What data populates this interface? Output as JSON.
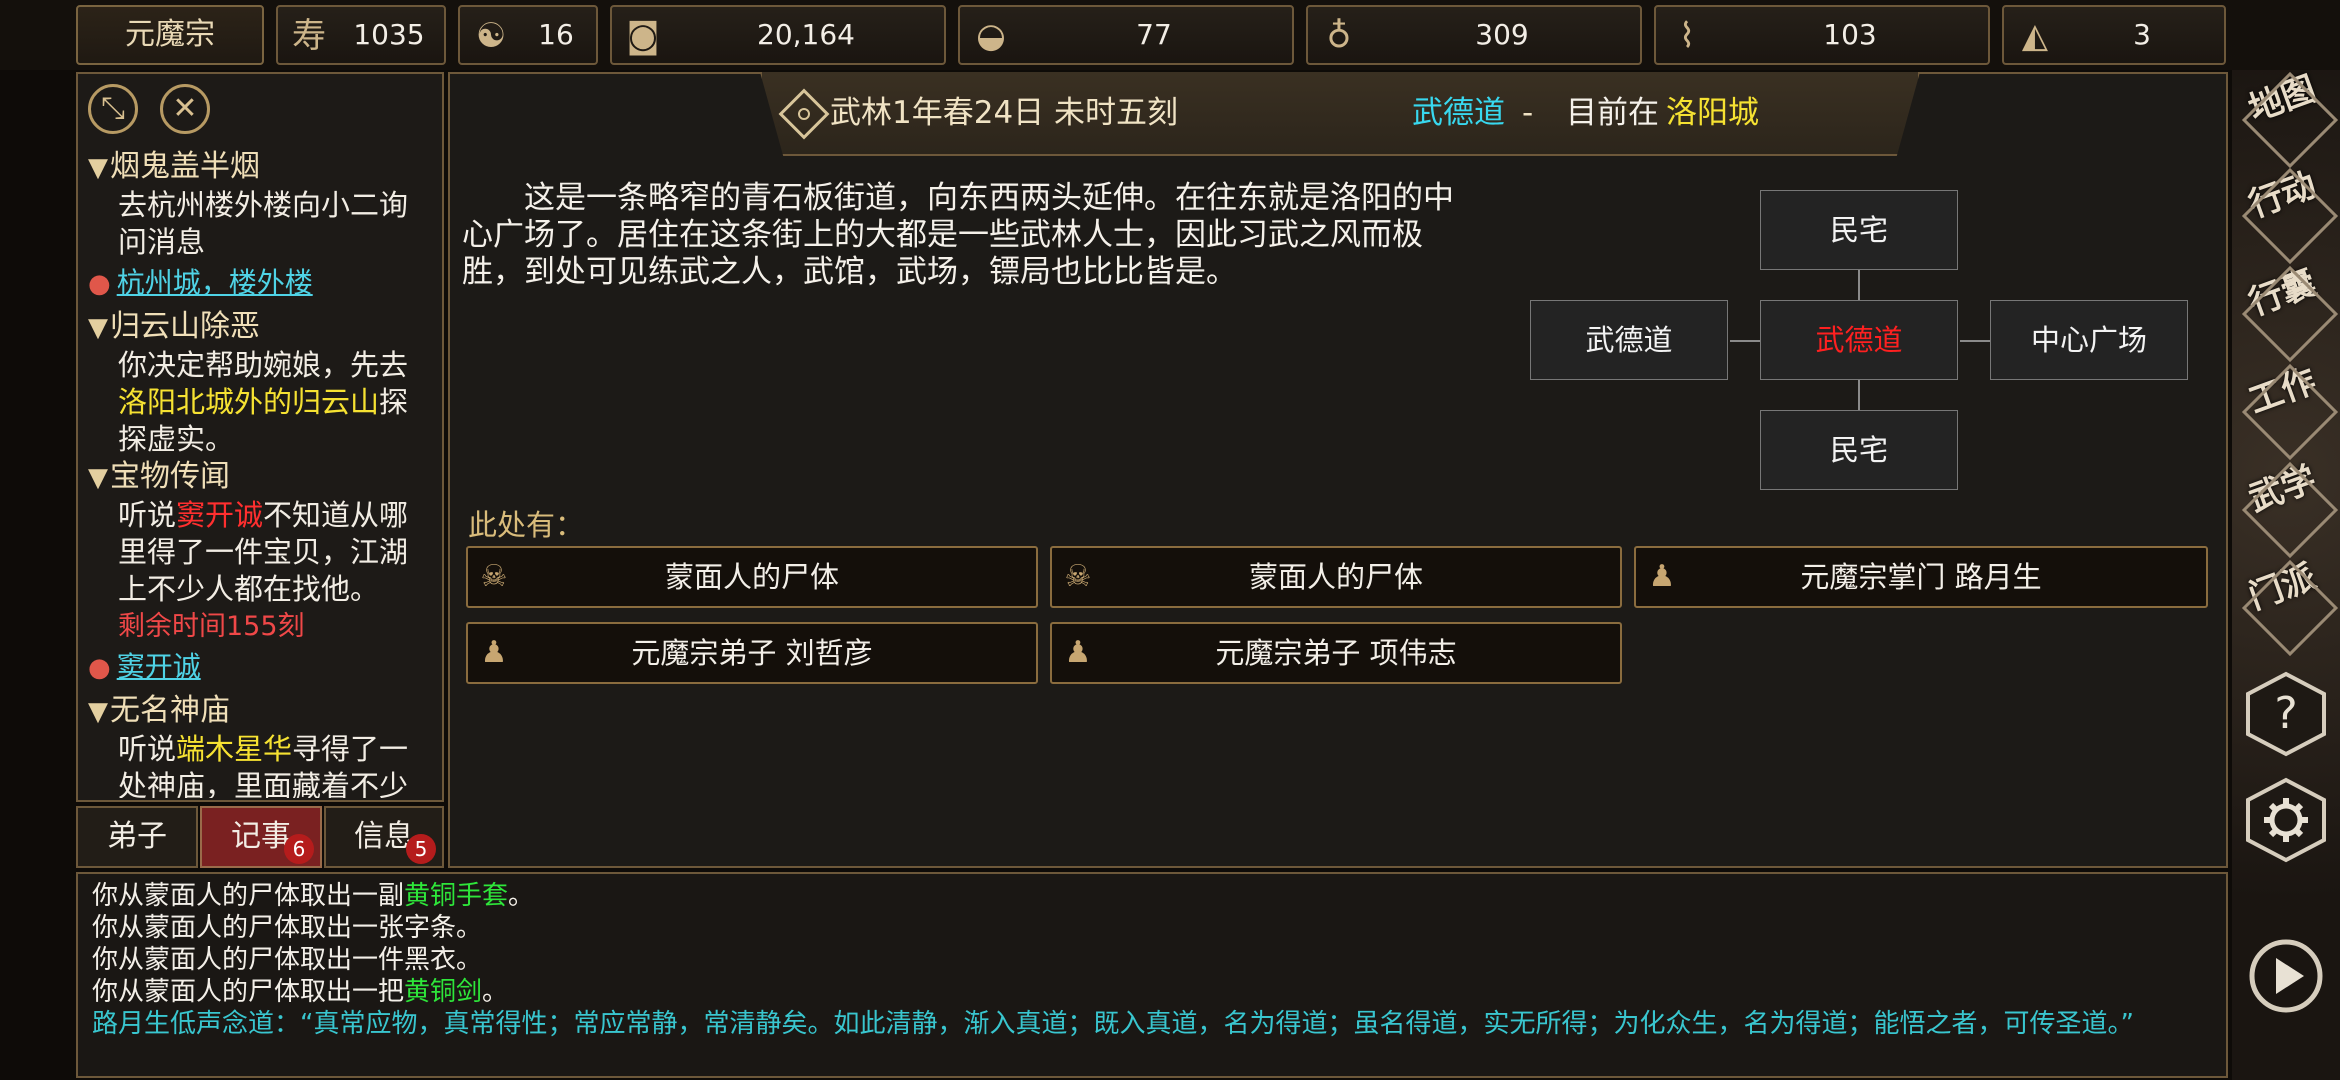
{
  "top_bar": {
    "sect_name": "元魔宗",
    "resources": [
      {
        "icon": "longevity-icon",
        "value": "1035"
      },
      {
        "icon": "yin-yang-icon",
        "value": "16"
      },
      {
        "icon": "coin-icon",
        "value": "20,164"
      },
      {
        "icon": "food-bowl-icon",
        "value": "77"
      },
      {
        "icon": "gourd-icon",
        "value": "309"
      },
      {
        "icon": "scroll-icon",
        "value": "103"
      },
      {
        "icon": "ore-icon",
        "value": "3"
      }
    ]
  },
  "quest_panel": {
    "quests": [
      {
        "title": "烟鬼盖半烟",
        "body": "去杭州楼外楼向小二询问消息",
        "location": "杭州城，楼外楼"
      },
      {
        "title": "归云山除恶",
        "body_pre": "你决定帮助婉娘，先去",
        "body_highlight": "洛阳北城外的归云山",
        "body_post": "探探虚实。"
      },
      {
        "title": "宝物传闻",
        "body_pre": "听说",
        "body_highlight": "窦开诚",
        "body_post": "不知道从哪里得了一件宝贝，江湖上不少人都在找他。",
        "remaining": "剩余时间155刻",
        "location": "窦开诚"
      },
      {
        "title": "无名神庙",
        "body_pre": "听说",
        "body_highlight": "端木星华",
        "body_post": "寻得了一处神庙，里面藏着不少"
      }
    ],
    "tabs": [
      {
        "label": "弟子"
      },
      {
        "label": "记事",
        "badge": "6",
        "active": true
      },
      {
        "label": "信息",
        "badge": "5"
      }
    ]
  },
  "header": {
    "date": "武林1年春24日 未时五刻",
    "place_name": "武德道",
    "separator": "-",
    "current_prefix": "目前在",
    "current_city": "洛阳城"
  },
  "scene": {
    "description": "这是一条略窄的青石板街道，向东西两头延伸。在往东就是洛阳的中心广场了。居住在这条街上的大都是一些武林人士，因此习武之风而极胜，到处可见练武之人，武馆，武场，镖局也比比皆是。",
    "map": {
      "north": "民宅",
      "west": "武德道",
      "center": "武德道",
      "east": "中心广场",
      "south": "民宅"
    },
    "here_label": "此处有：",
    "entities": [
      {
        "icon": "skull-icon",
        "label": "蒙面人的尸体"
      },
      {
        "icon": "skull-icon",
        "label": "蒙面人的尸体"
      },
      {
        "icon": "person-icon",
        "label": "元魔宗掌门 路月生"
      },
      {
        "icon": "person-icon",
        "label": "元魔宗弟子 刘哲彦"
      },
      {
        "icon": "person-icon",
        "label": "元魔宗弟子 项伟志"
      }
    ]
  },
  "log": {
    "lines": [
      {
        "pre": "你从蒙面人的尸体取出一副",
        "item": "黄铜手套",
        "post": "。"
      },
      {
        "pre": "你从蒙面人的尸体取出一张字条。",
        "item": "",
        "post": ""
      },
      {
        "pre": "你从蒙面人的尸体取出一件黑衣。",
        "item": "",
        "post": ""
      },
      {
        "pre": "你从蒙面人的尸体取出一把",
        "item": "黄铜剑",
        "post": "。"
      }
    ],
    "chant": "路月生低声念道：“真常应物，真常得性；常应常静，常清静矣。如此清静，渐入真道；既入真道，名为得道；虽名得道，实无所得；为化众生，名为得道；能悟之者，可传圣道。”"
  },
  "right_menu": {
    "items": [
      {
        "label": "地图"
      },
      {
        "label": "行动"
      },
      {
        "label": "行囊"
      },
      {
        "label": "工作"
      },
      {
        "label": "武学"
      },
      {
        "label": "门派"
      }
    ],
    "help": "?",
    "settings_icon": "gear-icon",
    "play_icon": "play-icon"
  }
}
